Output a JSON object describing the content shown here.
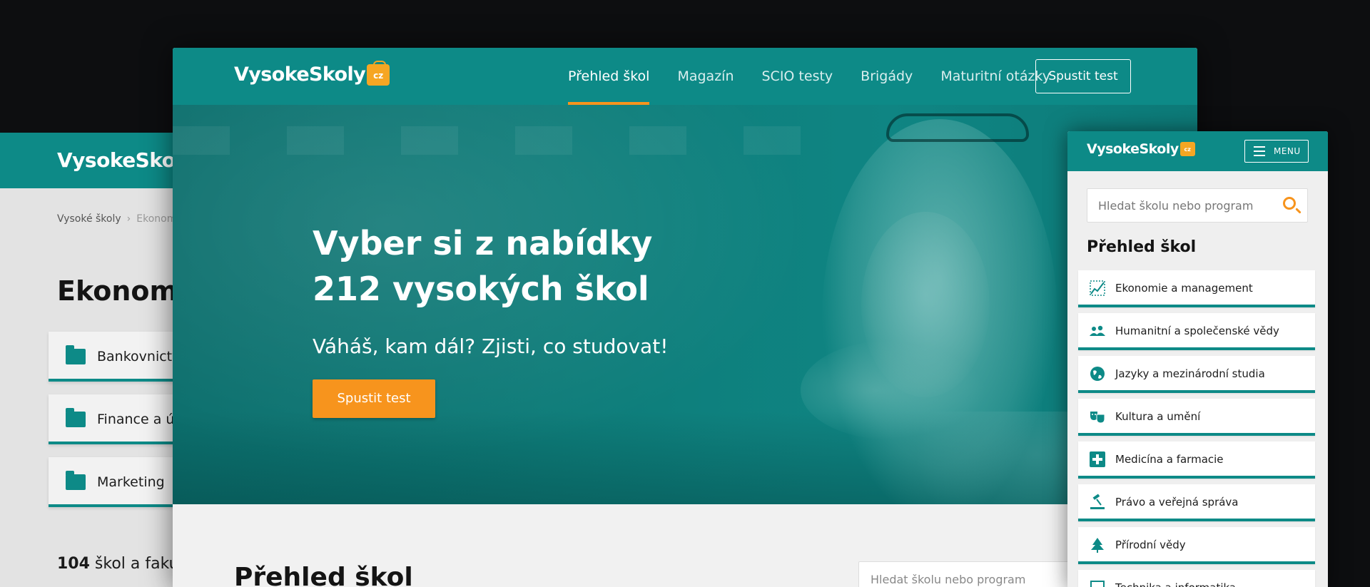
{
  "back_window": {
    "logo": "VysokeSkoly",
    "breadcrumb": {
      "home": "Vysoké školy",
      "separator": "›",
      "current": "Ekonom"
    },
    "title": "Ekonomie",
    "cards": [
      "Bankovnictv",
      "Finance a úč",
      "Marketing"
    ],
    "count_number": "104",
    "count_text": " škol a fakul"
  },
  "main_window": {
    "logo": {
      "text": "VysokeSkoly",
      "badge": "cz"
    },
    "menu": [
      {
        "label": "Přehled škol",
        "active": true
      },
      {
        "label": "Magazín",
        "active": false
      },
      {
        "label": "SCIO testy",
        "active": false
      },
      {
        "label": "Brigády",
        "active": false
      },
      {
        "label": "Maturitní otázky",
        "active": false
      }
    ],
    "nav_button": "Spustit test",
    "hero": {
      "title_line1": "Vyber si z nabídky",
      "title_line2": "212 vysokých škol",
      "subtitle": "Váháš, kam dál? Zjisti, co studovat!",
      "button": "Spustit test"
    },
    "section_title": "Přehled škol",
    "search_placeholder": "Hledat školu nebo program"
  },
  "mobile_window": {
    "logo": {
      "text": "VysokeSkoly",
      "badge": "cz"
    },
    "menu_button": "MENU",
    "search_placeholder": "Hledat školu nebo program",
    "heading": "Přehled škol",
    "items": [
      {
        "label": "Ekonomie a management",
        "icon": "chart-icon"
      },
      {
        "label": "Humanitní a společenské vědy",
        "icon": "people-icon"
      },
      {
        "label": "Jazyky a mezinárodní studia",
        "icon": "globe-icon"
      },
      {
        "label": "Kultura a umění",
        "icon": "masks-icon"
      },
      {
        "label": "Medicína a farmacie",
        "icon": "cross-icon"
      },
      {
        "label": "Právo a veřejná správa",
        "icon": "gavel-icon"
      },
      {
        "label": "Přírodní vědy",
        "icon": "tree-icon"
      },
      {
        "label": "Technika a informatika",
        "icon": "computer-icon"
      }
    ]
  },
  "colors": {
    "brand": "#0d8a87",
    "accent": "#f7941d",
    "background": "#0d0e10"
  }
}
